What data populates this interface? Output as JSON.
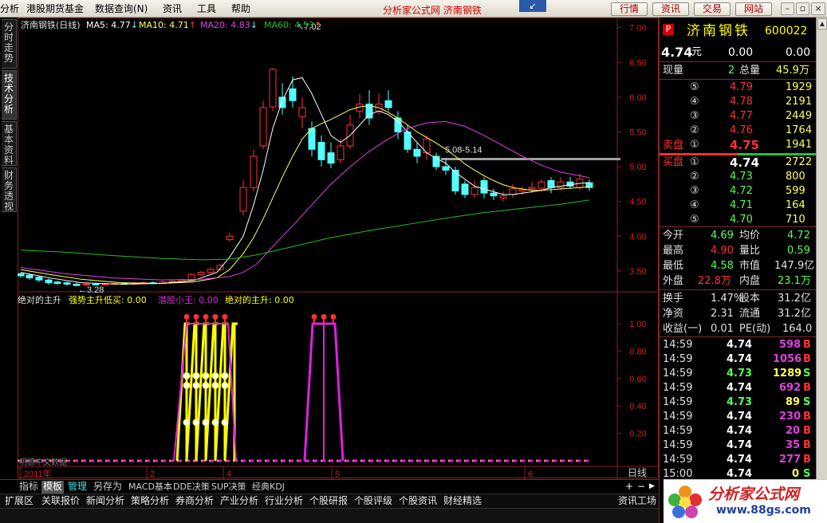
{
  "menu": {
    "items": [
      "分析",
      "港股期货基金",
      "数据查询(N)",
      "资讯",
      "工具",
      "帮助"
    ],
    "center_title": "分析家公式网 济南钢铁",
    "right_buttons": [
      "行情",
      "资讯",
      "交易",
      "网站"
    ]
  },
  "side_tabs": [
    "分时走势",
    "技术分析",
    "基本资料",
    "财务透视"
  ],
  "chart_header": {
    "name": "济南钢铁(日线)",
    "ma5": "MA5: 4.77",
    "ma10": "MA10: 4.71",
    "ma20": "MA20: 4.83",
    "ma60": "MA60: 4.53",
    "ma5_arrow": "↓",
    "ma10_arrow": "↑",
    "ma20_arrow": "↓",
    "ma60_arrow": "↑"
  },
  "indicator_header": {
    "t1": "绝对的主升",
    "t2": "强势主升低买: 0.00",
    "t3": "潜股小王: 0.00",
    "t4": "绝对的主升: 0.00"
  },
  "chart_data": [
    {
      "type": "candlestick",
      "title": "济南钢铁(日线)",
      "y_ticks": [
        "7.00",
        "6.50",
        "6.00",
        "5.50",
        "5.00",
        "4.50",
        "4.00",
        "3.50"
      ],
      "ylim": [
        3.2,
        7.1
      ],
      "x_ticks": [
        "2011年",
        "2",
        "4",
        "5",
        "6"
      ],
      "annotations": [
        "7.02",
        "5.08-5.14",
        "3.28"
      ],
      "series": [
        {
          "name": "MA5",
          "color": "#ffffff"
        },
        {
          "name": "MA10",
          "color": "#ffff60"
        },
        {
          "name": "MA20",
          "color": "#e040e0"
        },
        {
          "name": "MA60",
          "color": "#20c020"
        }
      ]
    },
    {
      "type": "line",
      "title": "绝对的主升",
      "y_ticks": [
        "1.00",
        "0.80",
        "0.60",
        "0.40",
        "0.20"
      ],
      "ylim": [
        0,
        1.05
      ],
      "series": [
        {
          "name": "强势主升低买",
          "color": "#ffff00"
        },
        {
          "name": "潜股小王",
          "color": "#e020e0"
        }
      ]
    }
  ],
  "period_label": "日线",
  "watermark": "明德中文数据",
  "bottom_tabs": [
    "指标",
    "模板",
    "管理",
    "另存为",
    "MACD基本",
    "DDE决策",
    "SUP决策",
    "经典KDJ"
  ],
  "toolbar": [
    "扩展区",
    "关联报价",
    "新闻分析",
    "策略分析",
    "券商分析",
    "产业分析",
    "行业分析",
    "个股研报",
    "个股评级",
    "个股资讯",
    "财经精选",
    "资讯工场"
  ],
  "quote": {
    "marker": "P",
    "name": "济南钢铁",
    "code": "600022",
    "price": "4.74",
    "price_unit": "元",
    "change": "0.00",
    "change_pct": "0.00",
    "volume_now_label": "现量",
    "volume_now": "2",
    "total_volume_label": "总量",
    "total_volume": "45.9万",
    "sell_label": "卖盘",
    "sells": [
      {
        "level": "⑤",
        "price": "4.79",
        "vol": "1929"
      },
      {
        "level": "④",
        "price": "4.78",
        "vol": "2191"
      },
      {
        "level": "③",
        "price": "4.77",
        "vol": "2449"
      },
      {
        "level": "②",
        "price": "4.76",
        "vol": "1764"
      },
      {
        "level": "①",
        "price": "4.75",
        "vol": "1941"
      }
    ],
    "buy_label": "买盘",
    "buys": [
      {
        "level": "①",
        "price": "4.74",
        "vol": "2722"
      },
      {
        "level": "②",
        "price": "4.73",
        "vol": "800"
      },
      {
        "level": "③",
        "price": "4.72",
        "vol": "599"
      },
      {
        "level": "④",
        "price": "4.71",
        "vol": "164"
      },
      {
        "level": "⑤",
        "price": "4.70",
        "vol": "710"
      }
    ],
    "stats": [
      {
        "l1": "今开",
        "v1": "4.69",
        "l2": "均价",
        "v2": "4.72"
      },
      {
        "l1": "最高",
        "v1": "4.90",
        "l2": "量比",
        "v2": "0.59"
      },
      {
        "l1": "最低",
        "v1": "4.58",
        "l2": "市值",
        "v2": "147.9亿"
      },
      {
        "l1": "外盘",
        "v1": "22.8万",
        "l2": "内盘",
        "v2": "23.1万"
      }
    ],
    "stats2": [
      {
        "l1": "换手",
        "v1": "1.47%",
        "l2": "股本",
        "v2": "31.2亿"
      },
      {
        "l1": "净资",
        "v1": "2.31",
        "l2": "流通",
        "v2": "31.2亿"
      },
      {
        "l1": "收益(一)",
        "v1": "0.01",
        "l2": "PE(动)",
        "v2": "164.0"
      }
    ],
    "ticks": [
      {
        "time": "14:59",
        "price": "4.74",
        "vol": "598",
        "side": "B"
      },
      {
        "time": "14:59",
        "price": "4.74",
        "vol": "1056",
        "side": "B"
      },
      {
        "time": "14:59",
        "price": "4.73",
        "vol": "1289",
        "side": "S"
      },
      {
        "time": "14:59",
        "price": "4.74",
        "vol": "692",
        "side": "B"
      },
      {
        "time": "14:59",
        "price": "4.73",
        "vol": "89",
        "side": "S"
      },
      {
        "time": "14:59",
        "price": "4.74",
        "vol": "230",
        "side": "B"
      },
      {
        "time": "14:59",
        "price": "4.74",
        "vol": "20",
        "side": "B"
      },
      {
        "time": "14:59",
        "price": "4.74",
        "vol": "35",
        "side": "B"
      },
      {
        "time": "14:59",
        "price": "4.74",
        "vol": "277",
        "side": "B"
      },
      {
        "time": "15:00",
        "price": "4.74",
        "vol": "0",
        "side": "S"
      }
    ]
  },
  "badge": {
    "title": "分析家公式网",
    "url": "www.88gs.com"
  },
  "colors": {
    "up": "#ff3232",
    "down": "#54ffff",
    "yellow": "#ffff00",
    "magenta": "#e020e0",
    "green": "#20c020",
    "label": "#e0e0e0"
  }
}
